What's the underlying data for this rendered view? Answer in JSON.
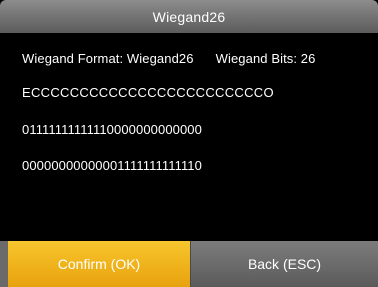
{
  "title": "Wiegand26",
  "format": {
    "format_text": "Wiegand Format: Wiegand26",
    "bits_text": "Wiegand Bits: 26"
  },
  "parity_pattern": "ECCCCCCCCCCCCCCCCCCCCCCCCO",
  "even_mask": "01111111111110000000000000",
  "odd_mask": "00000000000001111111111110",
  "buttons": {
    "confirm": "Confirm (OK)",
    "back": "Back (ESC)"
  },
  "colors": {
    "confirm_bg": "#efb21b",
    "back_bg": "#6a6a6a",
    "titlebar_bg": "#767676",
    "background": "#000000"
  }
}
